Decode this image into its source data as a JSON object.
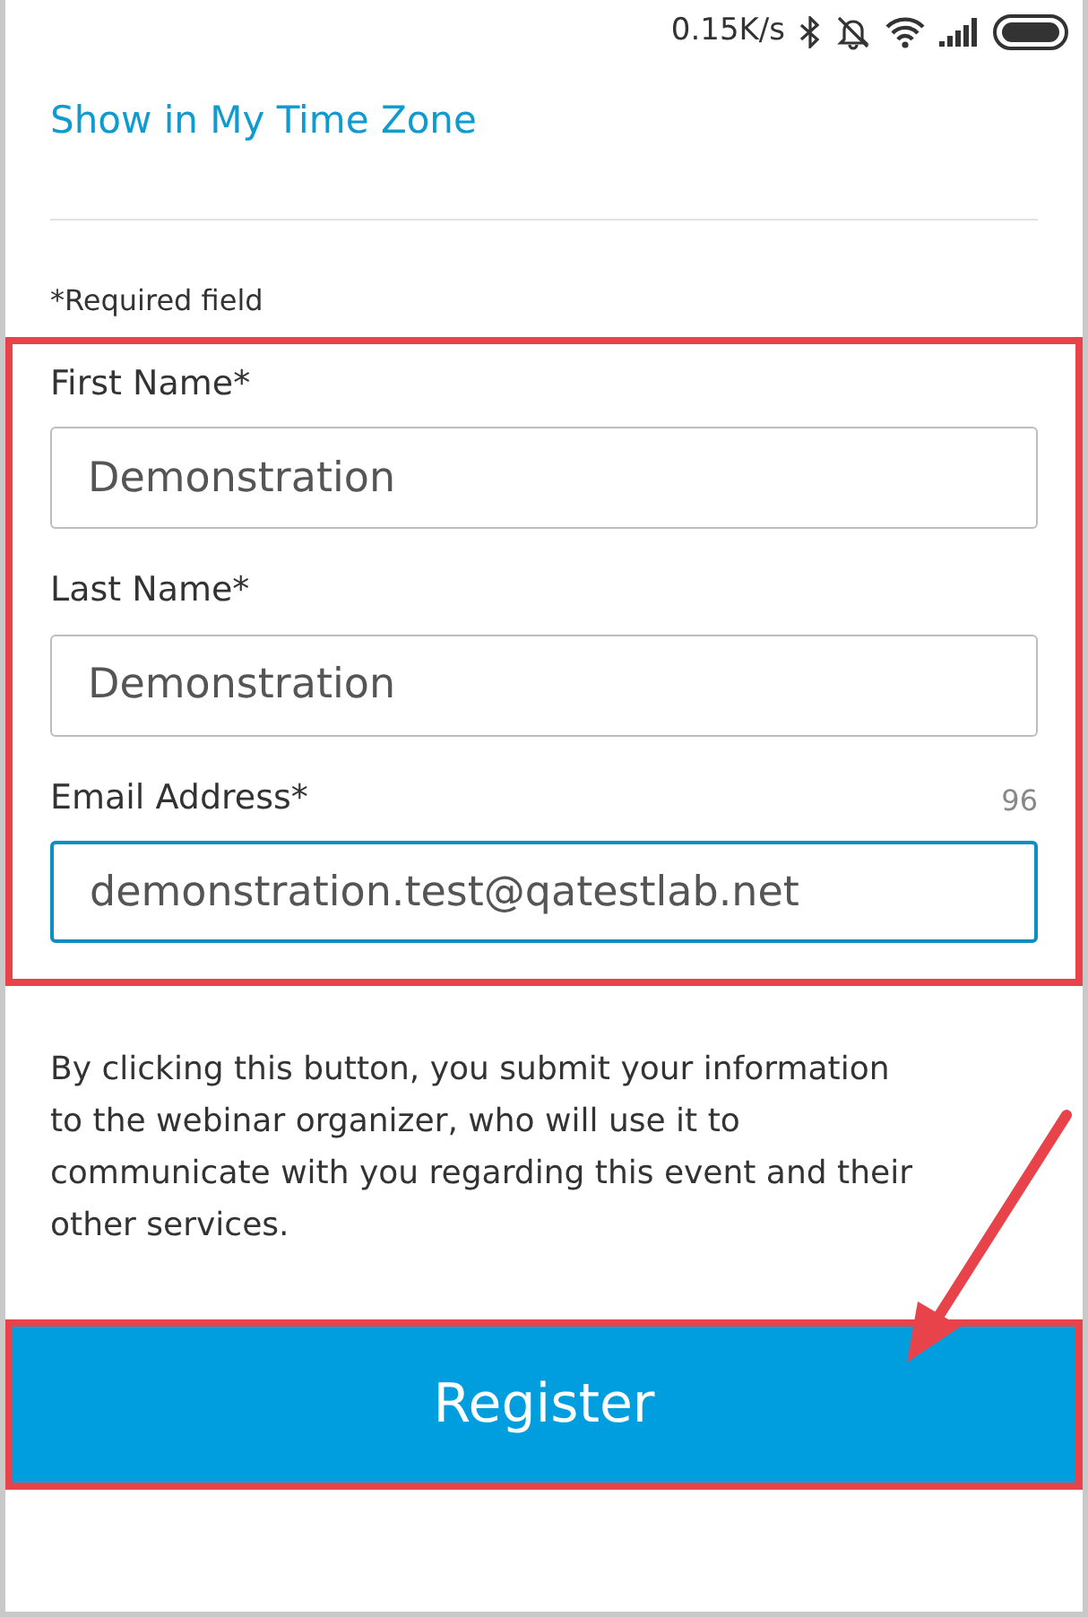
{
  "status_bar": {
    "network_speed": "0.15K/s"
  },
  "time_zone_link": "Show in My Time Zone",
  "required_note": "*Required field",
  "form": {
    "highlighted": true,
    "fields": [
      {
        "label": "First Name*",
        "value": "Demonstration",
        "focused": false
      },
      {
        "label": "Last Name*",
        "value": "Demonstration",
        "focused": false
      },
      {
        "label": "Email Address*",
        "value": "demonstration.test@qatestlab.net",
        "focused": true,
        "counter": "96"
      }
    ]
  },
  "consent_text": "By clicking this button, you submit your information to the webinar organizer, who will use it to communicate with you regarding this event and their other services.",
  "register_button": {
    "label": "Register",
    "highlighted": true,
    "arrow": true
  }
}
